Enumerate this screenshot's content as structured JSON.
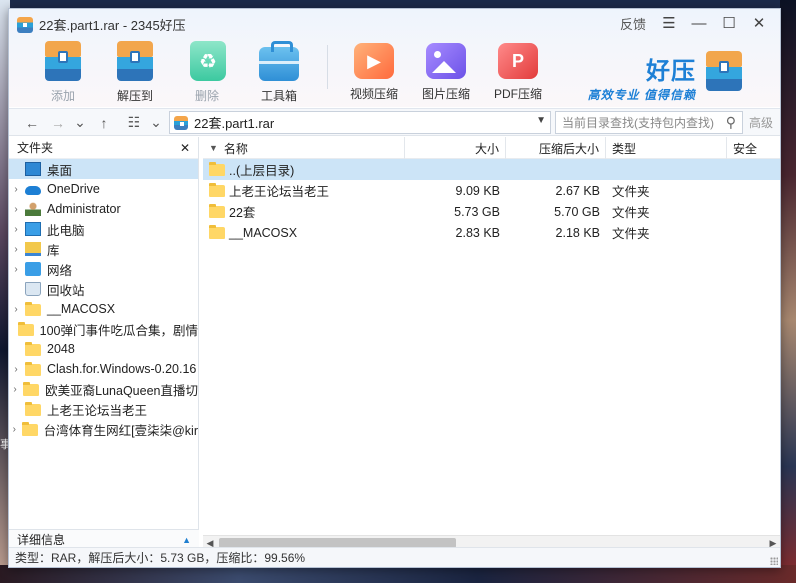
{
  "window": {
    "title": "22套.part1.rar - 2345好压",
    "feedback_label": "反馈",
    "menu_glyph": "☰",
    "minimize_glyph": "—",
    "maximize_glyph": "☐",
    "close_glyph": "✕"
  },
  "toolbar": {
    "add_label": "添加",
    "extract_label": "解压到",
    "delete_label": "删除",
    "toolbox_label": "工具箱",
    "video_label": "视频压缩",
    "image_label": "图片压缩",
    "pdf_label": "PDF压缩"
  },
  "brand": {
    "name": "好压",
    "slogan": "高效专业  值得信赖"
  },
  "address": {
    "path": "22套.part1.rar",
    "search_placeholder": "当前目录查找(支持包内查找)",
    "advanced_label": "高级"
  },
  "left_panel": {
    "title": "文件夹",
    "details_label": "详细信息",
    "tree": [
      {
        "label": "桌面",
        "icon": "desktop-icon",
        "arrow": ""
      },
      {
        "label": "OneDrive",
        "icon": "cloud-icon",
        "arrow": "›"
      },
      {
        "label": "Administrator",
        "icon": "user-icon",
        "arrow": "›"
      },
      {
        "label": "此电脑",
        "icon": "computer-icon",
        "arrow": "›"
      },
      {
        "label": "库",
        "icon": "library-icon",
        "arrow": "›"
      },
      {
        "label": "网络",
        "icon": "network-icon",
        "arrow": "›"
      },
      {
        "label": "回收站",
        "icon": "recycle-bin-icon",
        "arrow": ""
      },
      {
        "label": "__MACOSX",
        "icon": "folder-icon",
        "arrow": "›"
      },
      {
        "label": "100弹门事件吃瓜合集，剧情",
        "icon": "folder-icon",
        "arrow": ""
      },
      {
        "label": "2048",
        "icon": "folder-icon",
        "arrow": ""
      },
      {
        "label": "Clash.for.Windows-0.20.16",
        "icon": "folder-icon",
        "arrow": "›"
      },
      {
        "label": "欧美亚裔LunaQueen直播切",
        "icon": "folder-icon",
        "arrow": "›"
      },
      {
        "label": "上老王论坛当老王",
        "icon": "folder-icon",
        "arrow": ""
      },
      {
        "label": "台湾体育生网红[壹柒柒@kir",
        "icon": "folder-icon",
        "arrow": "›"
      }
    ]
  },
  "file_list": {
    "columns": {
      "name": "名称",
      "size": "大小",
      "compressed": "压缩后大小",
      "type": "类型",
      "security": "安全"
    },
    "rows": [
      {
        "name": "..(上层目录)",
        "size": "",
        "compressed": "",
        "type": ""
      },
      {
        "name": "上老王论坛当老王",
        "size": "9.09 KB",
        "compressed": "2.67 KB",
        "type": "文件夹"
      },
      {
        "name": "22套",
        "size": "5.73 GB",
        "compressed": "5.70 GB",
        "type": "文件夹"
      },
      {
        "name": "__MACOSX",
        "size": "2.83 KB",
        "compressed": "2.18 KB",
        "type": "文件夹"
      }
    ]
  },
  "status": {
    "text": "类型：RAR，解压后大小：5.73 GB，压缩比：99.56%"
  },
  "background": {
    "text": "事"
  }
}
